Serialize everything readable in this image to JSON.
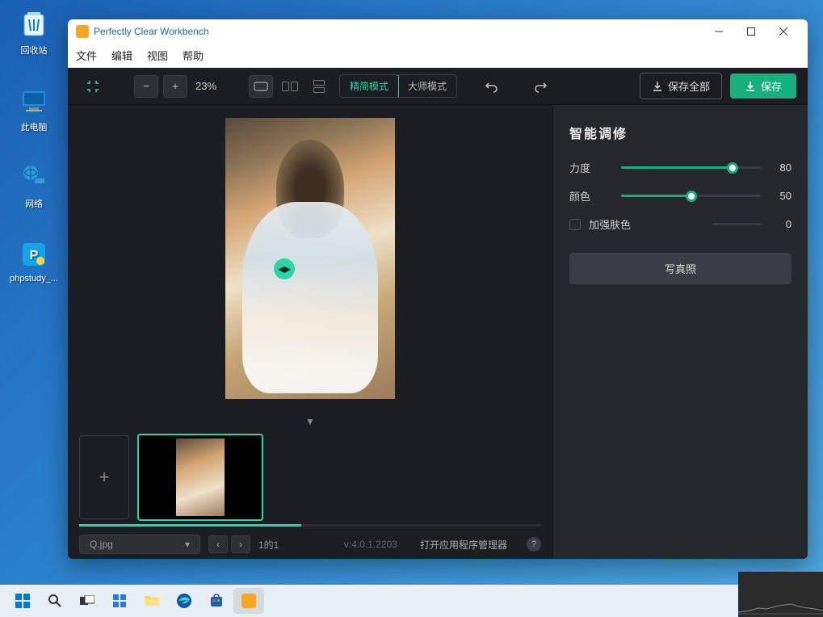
{
  "desktop": {
    "icons": [
      "回收站",
      "此电脑",
      "网络",
      "phpstudy_..."
    ]
  },
  "app": {
    "title": "Perfectly Clear Workbench",
    "menu": [
      "文件",
      "编辑",
      "视图",
      "帮助"
    ],
    "toolbar": {
      "zoom": "23%",
      "mode_simple": "精简模式",
      "mode_master": "大师模式",
      "save_all": "保存全部",
      "save": "保存"
    },
    "panel": {
      "title": "智能调修",
      "sliders": [
        {
          "label": "力度",
          "value": 80,
          "pct": 80
        },
        {
          "label": "颜色",
          "value": 50,
          "pct": 50
        }
      ],
      "enhance_skin": "加强肤色",
      "enhance_skin_value": 0,
      "preset_btn": "写真照"
    },
    "bottom": {
      "filename": "Q.jpg",
      "counter": "1的1",
      "version": "v:4.0.1.2203",
      "manager": "打开应用程序管理器"
    }
  }
}
